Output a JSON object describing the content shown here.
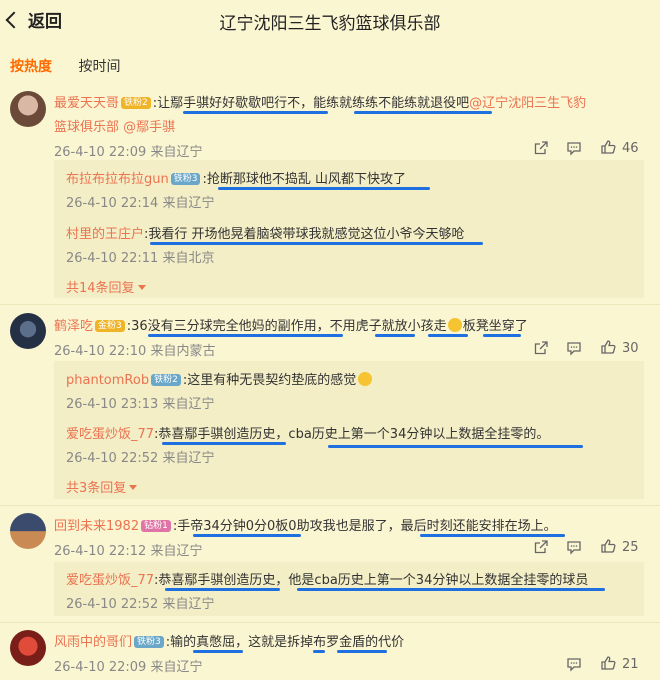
{
  "header": {
    "back_label": "返回",
    "title": "辽宁沈阳三生飞豹篮球俱乐部"
  },
  "tabs": [
    {
      "label": "按热度",
      "active": true
    },
    {
      "label": "按时间",
      "active": false
    }
  ],
  "comments": [
    {
      "user": "最爱天天哥",
      "badge": "铁粉2",
      "text_a": ":让鄢手骐好好歇歇吧行不，能练就练练不能练就退役吧",
      "mention_a": "@辽宁沈阳三生飞豹",
      "mention_b": "篮球俱乐部 @鄢手骐",
      "meta": "26-4-10 22:09 来自辽宁",
      "likes": "46",
      "replies": [
        {
          "user": "布拉布拉布拉gun",
          "badge": "铁粉3",
          "text": ":抢断那球他不捣乱 山风都下快攻了",
          "meta": "26-4-10 22:14 来自辽宁"
        },
        {
          "user": "村里的王庄户",
          "text": ":我看行 开场他晃着脑袋带球我就感觉这位小爷今天够呛",
          "meta": "26-4-10 22:11 来自北京"
        }
      ],
      "more": "共14条回复"
    },
    {
      "user": "鹤泽吃",
      "badge": "金粉3",
      "text_a": ":36没有三分球完全他妈的副作用，不用虎子就放小孩走",
      "text_b": "板凳坐穿了",
      "meta": "26-4-10 22:10 来自内蒙古",
      "likes": "30",
      "replies": [
        {
          "user": "phantomRob",
          "badge": "铁粉2",
          "text": ":这里有种无畏契约垫底的感觉",
          "meta": "26-4-10 23:13 来自辽宁"
        },
        {
          "user": "爱吃蛋炒饭_77",
          "text": ":恭喜鄢手骐创造历史，cba历史上第一个34分钟以上数据全挂零的。",
          "meta": "26-4-10 22:52 来自辽宁"
        }
      ],
      "more": "共3条回复"
    },
    {
      "user": "回到未来1982",
      "badge": "钻粉1",
      "text_a": ":手帝34分钟0分0板0助攻我也是服了，最后时刻还能安排在场上。",
      "meta": "26-4-10 22:12 来自辽宁",
      "likes": "25",
      "replies": [
        {
          "user": "爱吃蛋炒饭_77",
          "text": ":恭喜鄢手骐创造历史，他是cba历史上第一个34分钟以上数据全挂零的球员",
          "meta": "26-4-10 22:52 来自辽宁"
        }
      ]
    },
    {
      "user": "风雨中的哥们",
      "badge": "铁粉3",
      "text_a": ":输的真憋屈，这就是拆掉布罗金盾的代价",
      "meta": "26-4-10 22:09 来自辽宁",
      "likes": "21"
    }
  ],
  "colors": {
    "accent": "#ff6b00",
    "username": "#eb7350",
    "underline": "#1e6fe0",
    "bg": "#fbf6d2"
  }
}
